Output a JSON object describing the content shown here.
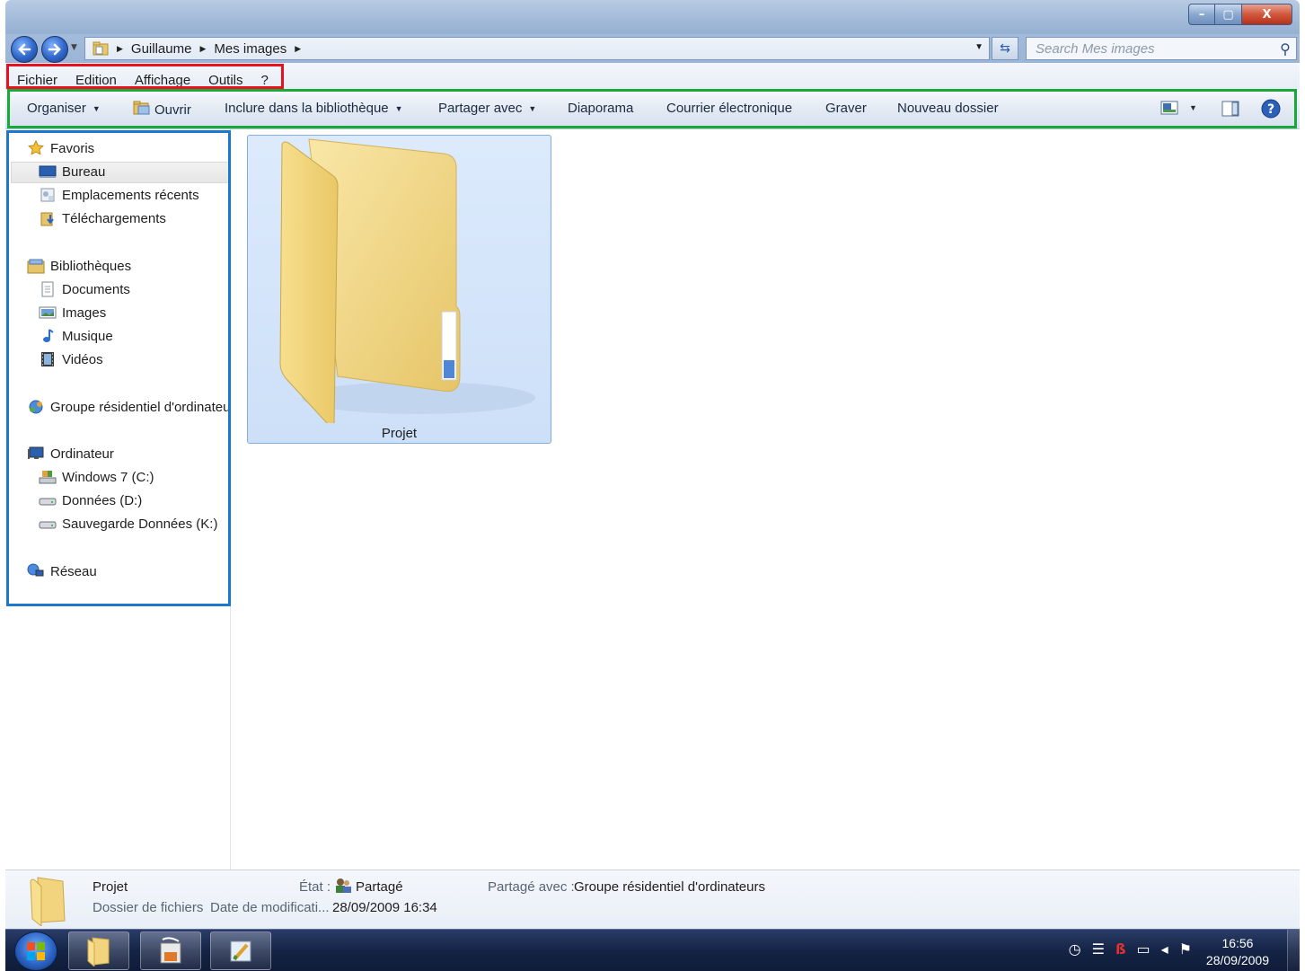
{
  "window": {
    "caption": {
      "minimize": "–",
      "maximize": "▢",
      "close": "X"
    }
  },
  "address": {
    "crumbs": [
      "Guillaume",
      "Mes images"
    ],
    "search_placeholder": "Search Mes images"
  },
  "menu": {
    "items": [
      "Fichier",
      "Edition",
      "Affichage",
      "Outils",
      "?"
    ]
  },
  "toolbar": {
    "organiser": "Organiser",
    "ouvrir": "Ouvrir",
    "inclure": "Inclure dans la bibliothèque",
    "partager": "Partager avec",
    "diaporama": "Diaporama",
    "courrier": "Courrier électronique",
    "graver": "Graver",
    "nouveau_dossier": "Nouveau dossier"
  },
  "nav": {
    "favoris": "Favoris",
    "bureau": "Bureau",
    "emplacements": "Emplacements récents",
    "telechargements": "Téléchargements",
    "bibliotheques": "Bibliothèques",
    "documents": "Documents",
    "images": "Images",
    "musique": "Musique",
    "videos": "Vidéos",
    "groupe": "Groupe résidentiel d'ordinateu",
    "ordinateur": "Ordinateur",
    "windows7": "Windows 7 (C:)",
    "donnees": "Données (D:)",
    "sauvegarde": "Sauvegarde Données (K:)",
    "reseau": "Réseau"
  },
  "content": {
    "items": [
      {
        "name": "Projet"
      }
    ]
  },
  "details": {
    "name": "Projet",
    "type": "Dossier de fichiers",
    "state_label": "État :",
    "state_value": "Partagé",
    "modified_label": "Date de modificati...",
    "modified_value": "28/09/2009 16:34",
    "shared_label": "Partagé avec :",
    "shared_value": "Groupe résidentiel d'ordinateurs"
  },
  "taskbar": {
    "time": "16:56",
    "date": "28/09/2009"
  },
  "colors": {
    "highlight_menu": "#e8111f",
    "highlight_toolbar": "#1aa83a",
    "highlight_nav": "#1b78cc",
    "selection": "#cde0f8"
  }
}
